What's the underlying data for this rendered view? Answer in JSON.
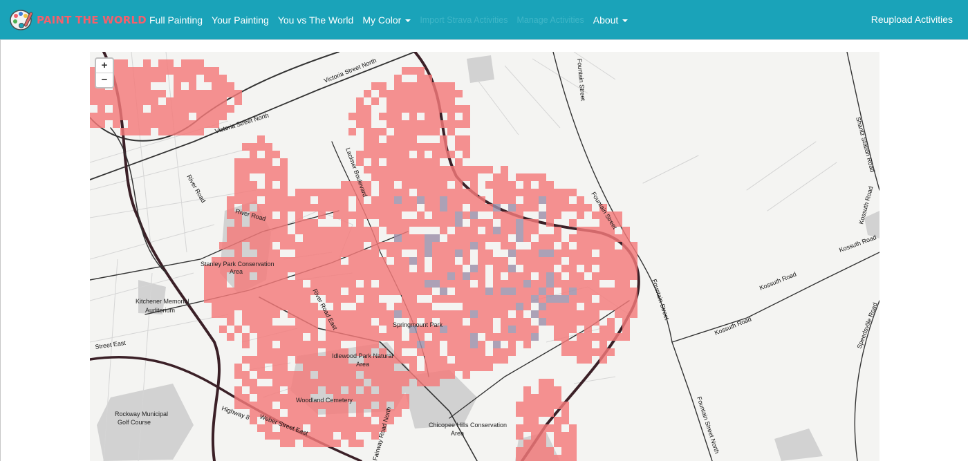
{
  "brand": {
    "name": "PAINT THE WORLD",
    "logo_icon": "palette-icon",
    "color": "#f4606c"
  },
  "nav": {
    "items": [
      {
        "label": "Full Painting",
        "dropdown": false,
        "disabled": false
      },
      {
        "label": "Your Painting",
        "dropdown": false,
        "disabled": false
      },
      {
        "label": "You vs The World",
        "dropdown": false,
        "disabled": false
      },
      {
        "label": "My Color",
        "dropdown": true,
        "disabled": false
      },
      {
        "label": "Import Strava Activities",
        "dropdown": false,
        "disabled": true
      },
      {
        "label": "Manage Activities",
        "dropdown": false,
        "disabled": true
      },
      {
        "label": "About",
        "dropdown": true,
        "disabled": false
      }
    ],
    "right_action": "Reupload Activities",
    "bar_color": "#1aa3b9"
  },
  "map": {
    "zoom_in": "+",
    "zoom_out": "−",
    "paint_color": "#f47a7a",
    "other_color": "#9c8fa8",
    "labels": {
      "victoria_1": "Victoria Street North",
      "victoria_2": "Victoria Street North",
      "river_road_1": "River Road",
      "river_road_2": "River Road",
      "lackner": "Lackner Boulevard",
      "fountain_1": "Fountain Street",
      "fountain_2": "Fountain Street",
      "fountain_3": "Fountain Street",
      "fountain_north": "Fountain Street North",
      "shantz": "Shantz Station Road",
      "kossuth_1": "Kossuth Road",
      "kossuth_2": "Kossuth Road",
      "kossuth_3": "Kossuth Road",
      "kossuth_4": "Kossuth Road",
      "stanley_1": "Stanley Park Conservation",
      "stanley_2": "Area",
      "auditorium_1": "Kitchener Memorial",
      "auditorium_2": "Auditorium",
      "river_road_east": "River Road East",
      "springmount": "Springmount Park",
      "idlewood_1": "Idlewood Park Natural",
      "idlewood_2": "Area",
      "woodland": "Woodland Cemetery",
      "rockway_1": "Rockway Municipal",
      "rockway_2": "Golf Course",
      "weber": "Weber Street East",
      "highway": "Highway 8",
      "street_east": "Street East",
      "chicopee_1": "Chicopee Hills Conservation",
      "chicopee_2": "Area",
      "fairway": "Fairway Road North",
      "speedsville": "Speedsville Road",
      "east_edge": "East"
    }
  }
}
